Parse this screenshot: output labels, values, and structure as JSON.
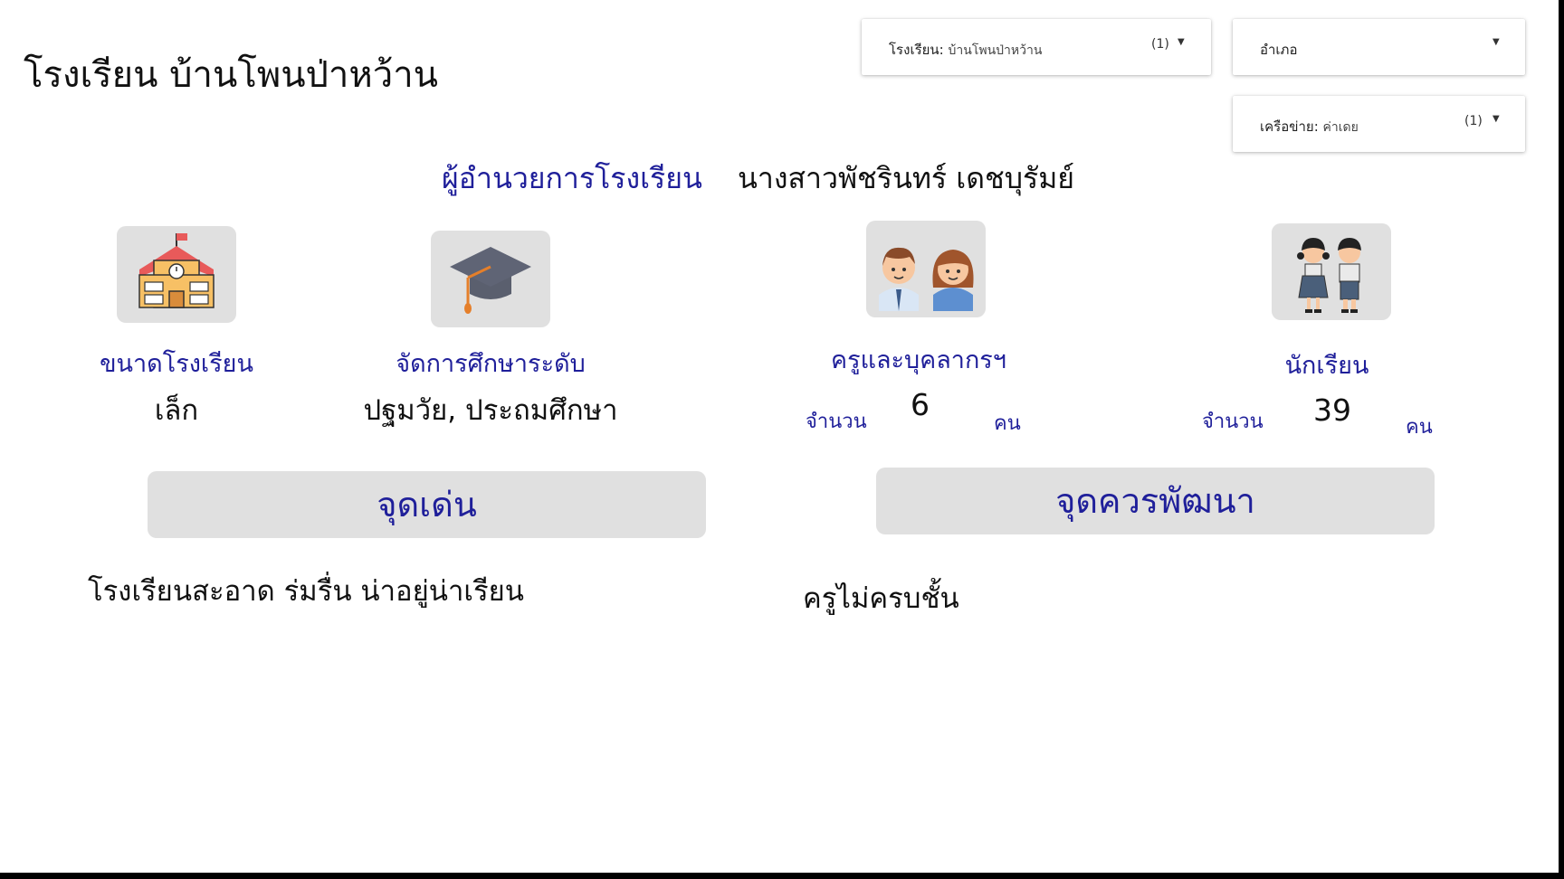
{
  "header": {
    "school_title": "โรงเรียน บ้านโพนป่าหว้าน"
  },
  "filters": {
    "school": {
      "label": "โรงเรียน",
      "value": "บ้านโพนป่าหว้าน",
      "count": "(1)"
    },
    "district": {
      "label": "อำเภอ"
    },
    "network": {
      "label": "เครือข่าย",
      "value": "ค่าเดย",
      "count": "(1)"
    }
  },
  "director": {
    "label": "ผู้อำนวยการโรงเรียน",
    "name": "นางสาวพัชรินทร์ เดชบุรัมย์"
  },
  "cards": {
    "size": {
      "caption": "ขนาดโรงเรียน",
      "value": "เล็ก",
      "icon": "school-building-icon"
    },
    "level": {
      "caption": "จัดการศึกษาระดับ",
      "value": "ปฐมวัย, ประถมศึกษา",
      "icon": "graduation-cap-icon"
    },
    "teachers": {
      "caption": "ครูและบุคลากรฯ",
      "count_label": "จำนวน",
      "count": "6",
      "unit": "คน",
      "icon": "teachers-icon"
    },
    "students": {
      "caption": "นักเรียน",
      "count_label": "จำนวน",
      "count": "39",
      "unit": "คน",
      "icon": "students-icon"
    }
  },
  "strengths": {
    "heading": "จุดเด่น",
    "text": "โรงเรียนสะอาด ร่มรื่น น่าอยู่น่าเรียน"
  },
  "improvements": {
    "heading": "จุดควรพัฒนา",
    "text": "ครูไม่ครบชั้น"
  },
  "colors": {
    "accent": "#1f1f9a",
    "tile": "#e0e0e0",
    "frame": "#000000"
  }
}
